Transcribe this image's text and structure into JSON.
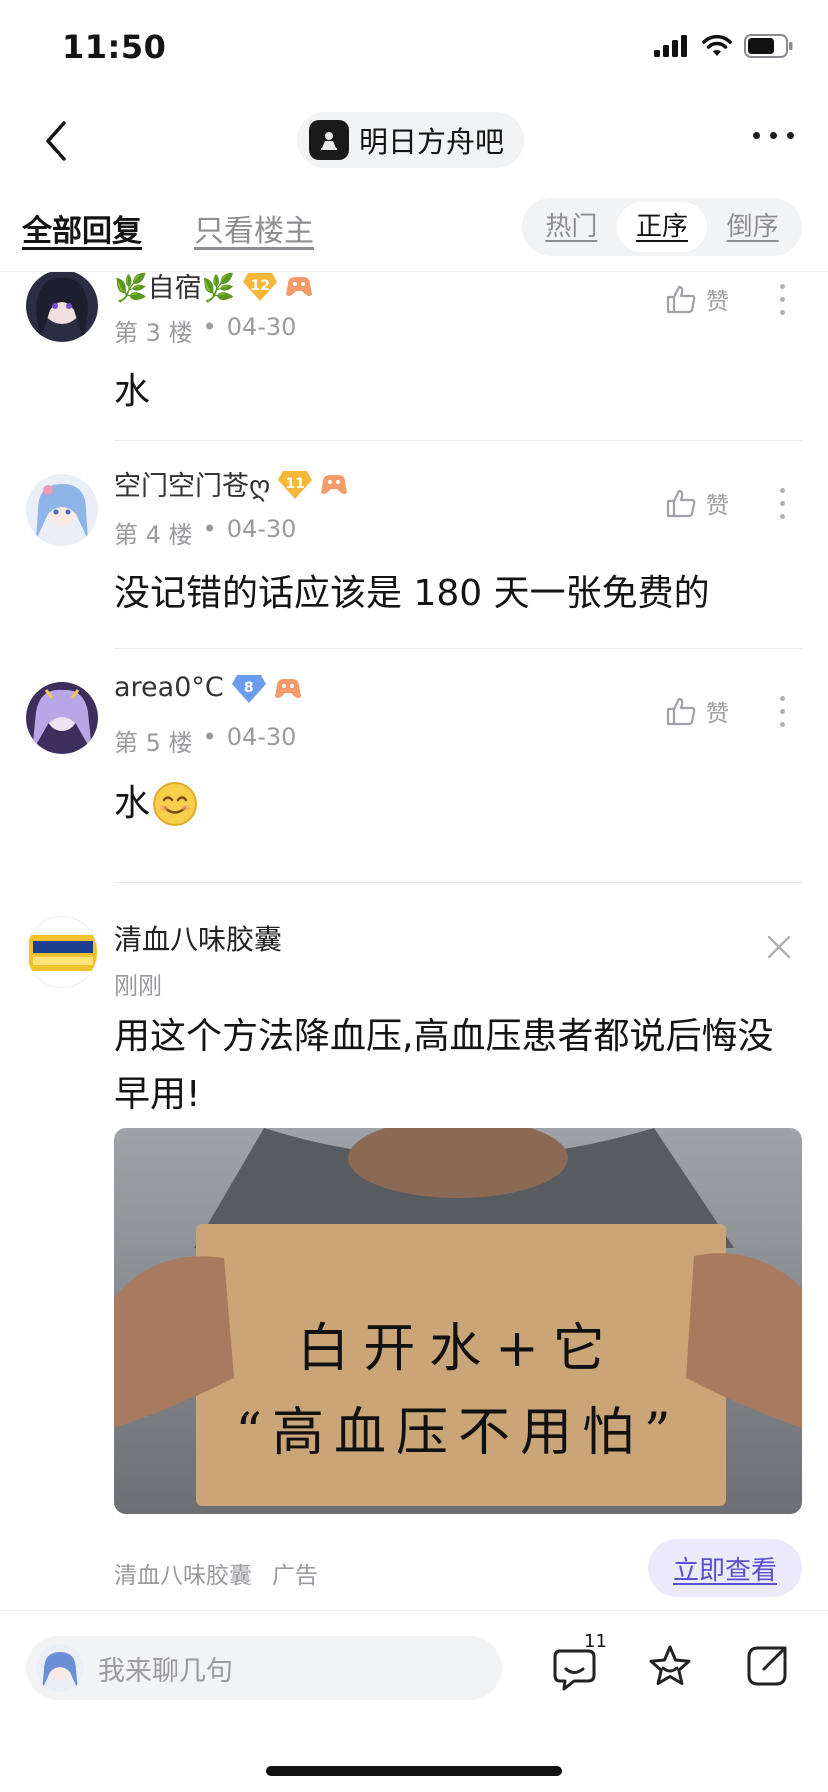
{
  "status_bar": {
    "time": "11:50"
  },
  "nav": {
    "forum_name": "明日方舟吧"
  },
  "tabs": {
    "all": "全部回复",
    "owner_only": "只看楼主",
    "sort": [
      "热门",
      "正序",
      "倒序"
    ],
    "active_sort": "正序"
  },
  "posts": [
    {
      "name": "🌿自宿🌿",
      "level": "12",
      "floor": "第 3 楼",
      "date": "04-30",
      "like_label": "赞",
      "body": "水"
    },
    {
      "name": "空门空门苍ღ",
      "level": "11",
      "floor": "第 4 楼",
      "date": "04-30",
      "like_label": "赞",
      "body": "没记错的话应该是 180 天一张免费的"
    },
    {
      "name": "area0°C",
      "level": "8",
      "floor": "第 5 楼",
      "date": "04-30",
      "like_label": "赞",
      "body": "水"
    }
  ],
  "ad": {
    "name": "清血八味胶囊",
    "time": "刚刚",
    "headline": "用这个方法降血压,高血压患者都说后悔没早用!",
    "image_text_line1": "白开水+它",
    "image_text_line2": "“高血压不用怕”",
    "source": "清血八味胶囊",
    "tag": "广告",
    "cta": "立即查看"
  },
  "bottom": {
    "placeholder": "我来聊几句",
    "comment_count": "11"
  }
}
